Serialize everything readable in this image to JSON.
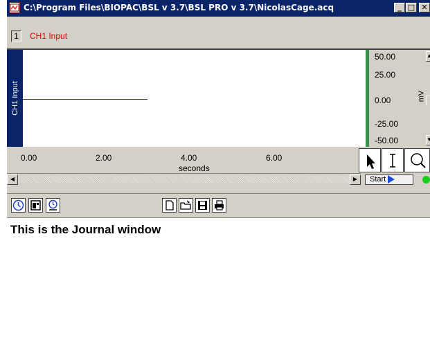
{
  "window": {
    "title": "C:\\Program Files\\BIOPAC\\BSL v 3.7\\BSL PRO v 3.7\\NicolasCage.acq",
    "minimize_glyph": "_",
    "maximize_glyph": "□",
    "close_glyph": "✕"
  },
  "channel": {
    "number": "1",
    "name": "CH1 Input",
    "side_label": "CH1 Input"
  },
  "y_scale": {
    "ticks": [
      "50.00",
      "25.00",
      "0.00",
      "-25.00",
      "-50.00"
    ],
    "unit": "mV"
  },
  "x_axis": {
    "ticks": [
      "0.00",
      "2.00",
      "4.00",
      "6.00"
    ],
    "unit": "seconds"
  },
  "controls": {
    "start_label": "Start"
  },
  "journal": {
    "text": "This is the Journal window"
  },
  "colors": {
    "title_bar": "#0a246a",
    "trace": "#e00000",
    "channel_name": "#e00000",
    "scale_bar": "#3a8f4a",
    "led": "#17d019",
    "start_arrow": "#1a4bd8"
  },
  "icons": {
    "window": "app-icon",
    "tools": [
      "arrow-cursor-icon",
      "ibeam-cursor-icon",
      "zoom-icon"
    ],
    "journal_left": [
      "clock-icon",
      "calendar-icon",
      "clock-arrow-icon"
    ],
    "journal_file": [
      "new-file-icon",
      "open-folder-icon",
      "save-disk-icon",
      "print-icon"
    ]
  },
  "trace_level": 0.0
}
